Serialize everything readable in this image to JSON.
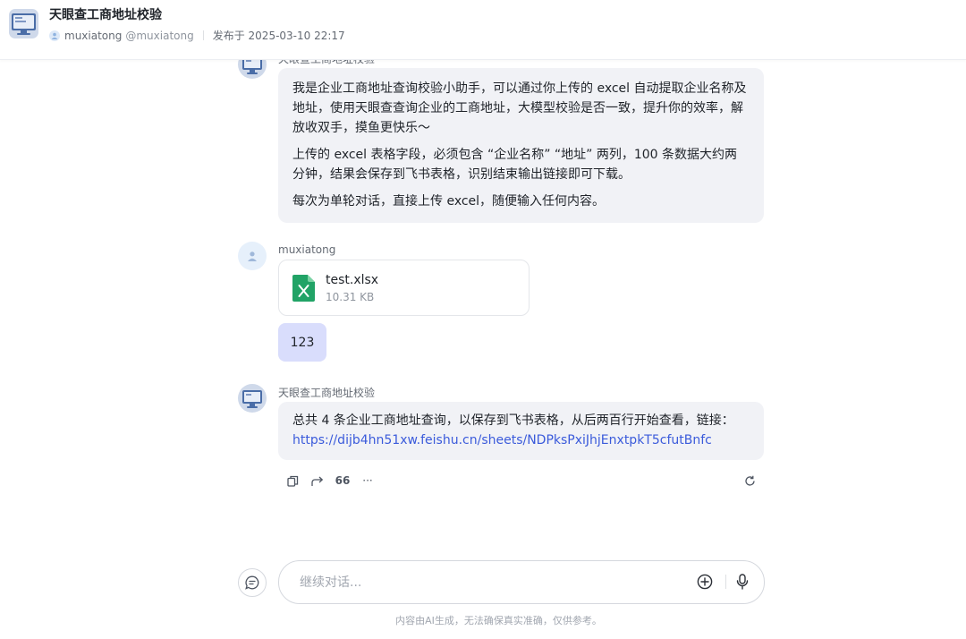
{
  "header": {
    "title": "天眼查工商地址校验",
    "author": "muxiatong",
    "handle": "@muxiatong",
    "published": "发布于 2025-03-10 22:17"
  },
  "messages": {
    "bot_intro": {
      "sender": "天眼查工商地址校验",
      "paragraphs": [
        "我是企业工商地址查询校验小助手，可以通过你上传的 excel 自动提取企业名称及地址，使用天眼查查询企业的工商地址，大模型校验是否一致，提升你的效率，解放收双手，摸鱼更快乐～",
        "上传的 excel 表格字段，必须包含 “企业名称” “地址” 两列，100 条数据大约两分钟，结果会保存到飞书表格，识别结束输出链接即可下载。",
        "每次为单轮对话，直接上传 excel，随便输入任何内容。"
      ]
    },
    "user": {
      "sender": "muxiatong",
      "file_name": "test.xlsx",
      "file_size": "10.31 KB",
      "text": "123"
    },
    "bot_reply": {
      "sender": "天眼查工商地址校验",
      "text": "总共 4 条企业工商地址查询，以保存到飞书表格，从后两百行开始查看，链接：",
      "link": "https://dijb4hn51xw.feishu.cn/sheets/NDPksPxiJhjEnxtpkT5cfutBnfc"
    }
  },
  "actions": {
    "quote_label": "66",
    "more_label": "···"
  },
  "input": {
    "placeholder": "继续对话..."
  },
  "footer": {
    "disclaimer": "内容由AI生成，无法确保真实准确，仅供参考。"
  },
  "colors": {
    "bubble": "#f1f2f6",
    "user_bubble": "#d9ddfc",
    "link": "#3b5bdb",
    "excel_green": "#21a366"
  }
}
